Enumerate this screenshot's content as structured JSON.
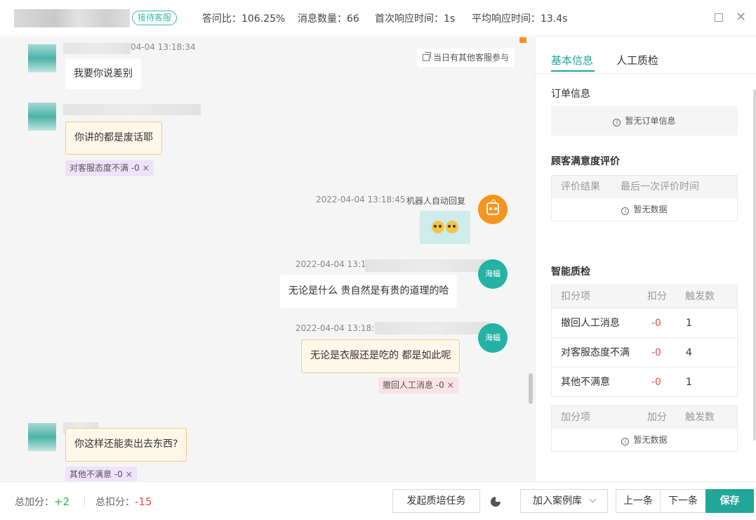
{
  "header": {
    "role_tag": "接待客服",
    "stats": [
      {
        "label": "答问比：106.25%"
      },
      {
        "label": "消息数量：66"
      },
      {
        "label": "首次响应时间：1s"
      },
      {
        "label": "平均响应时间：13.4s"
      }
    ]
  },
  "chat": {
    "other_agents_notice": "当日有其他客服参与",
    "messages": [
      {
        "time": "04-04 13:18:34",
        "text": "我要你说差别"
      },
      {
        "text": "你讲的都是废话耶",
        "tag": "对客服态度不满 -0"
      },
      {
        "time": "2022-04-04 13:18:45",
        "sender": "机器人自动回复",
        "text": "😇😇"
      },
      {
        "time": "2022-04-04 13:1",
        "avatar": "海蝠",
        "text": "无论是什么 贵自然是有贵的道理的哈"
      },
      {
        "time": "2022-04-04 13:18:5",
        "avatar": "海蝠",
        "text": "无论是衣服还是吃的 都是如此呢",
        "tag": "撤回人工消息 -0"
      },
      {
        "text": "你这样还能卖出去东西?",
        "tag": "其他不满意 -0"
      }
    ],
    "tag_close": "×"
  },
  "panel": {
    "tabs": [
      "基本信息",
      "人工质检"
    ],
    "order_title": "订单信息",
    "order_empty": "暂无订单信息",
    "satisfaction_title": "顾客满意度评价",
    "satisfaction_headers": [
      "评价结果",
      "最后一次评价时间"
    ],
    "satisfaction_empty": "暂无数据",
    "smart_qc_title": "智能质检",
    "deduct_headers": [
      "扣分项",
      "扣分",
      "触发数"
    ],
    "deduct_rows": [
      {
        "item": "撤回人工消息",
        "score": "-0",
        "count": "1"
      },
      {
        "item": "对客服态度不满",
        "score": "-0",
        "count": "4"
      },
      {
        "item": "其他不满意",
        "score": "-0",
        "count": "1"
      }
    ],
    "add_headers": [
      "加分项",
      "加分",
      "触发数"
    ],
    "add_empty": "暂无数据"
  },
  "footer": {
    "total_add_label": "总加分：",
    "total_add_value": "+2",
    "total_deduct_label": "总扣分：",
    "total_deduct_value": "-15",
    "training_button": "发起质培任务",
    "case_button": "加入案例库",
    "prev_button": "上一条",
    "next_button": "下一条",
    "save_button": "保存"
  },
  "colors": {
    "accent": "#22a699",
    "bot": "#f7941d",
    "plus": "#2db34a",
    "minus": "#f04a4a"
  }
}
